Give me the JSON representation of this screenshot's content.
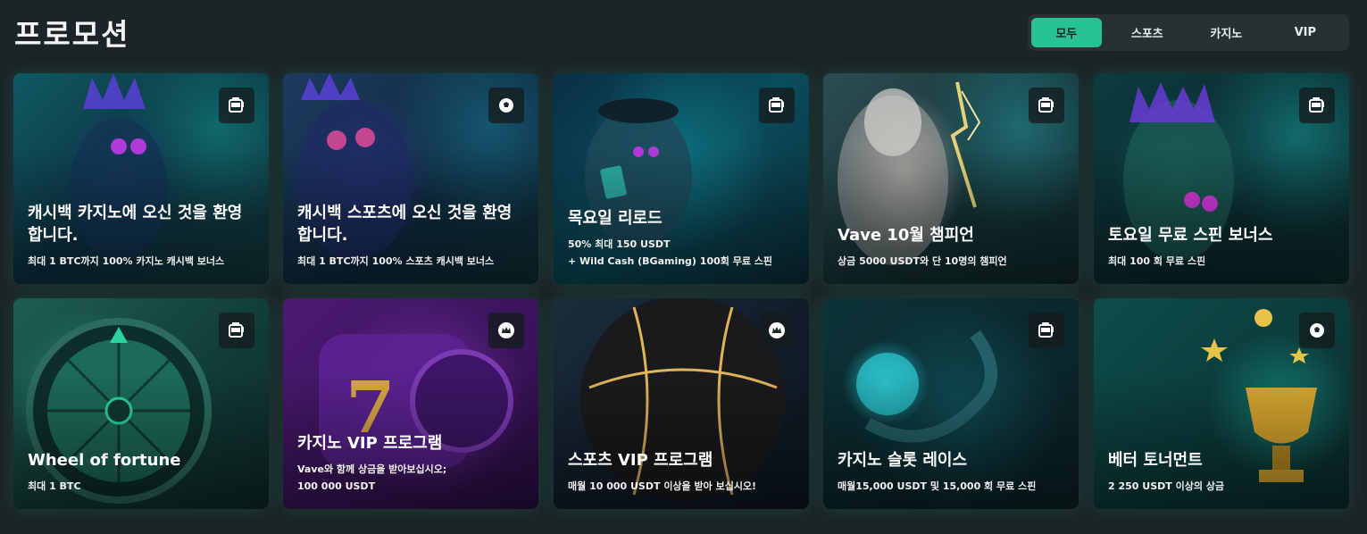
{
  "page": {
    "title": "프로모션"
  },
  "filters": [
    {
      "label": "모두",
      "active": true
    },
    {
      "label": "스포츠",
      "active": false
    },
    {
      "label": "카지노",
      "active": false
    },
    {
      "label": "VIP",
      "active": false
    }
  ],
  "promotions": [
    {
      "title": "캐시백 카지노에 오신 것을 환영 합니다.",
      "desc": "최대 1 BTC까지 100% 카지노 캐시백 보너스",
      "icon": "slot-machine-icon"
    },
    {
      "title": "캐시백 스포츠에 오신 것을 환영 합니다.",
      "desc": "최대 1 BTC까지 100% 스포츠 캐시백 보너스",
      "icon": "soccer-ball-icon"
    },
    {
      "title": "목요일 리로드",
      "desc": "50% 최대 150 USDT\n+ Wild Cash (BGaming) 100회 무료 스핀",
      "icon": "slot-machine-icon"
    },
    {
      "title": "Vave 10월 챔피언",
      "desc": "상금 5000 USDT와 단 10명의 챔피언",
      "icon": "slot-machine-icon"
    },
    {
      "title": "토요일 무료 스핀 보너스",
      "desc": "최대 100 회 무료 스핀",
      "icon": "slot-machine-icon"
    },
    {
      "title": "Wheel of fortune",
      "desc": "최대 1 BTC",
      "icon": "slot-machine-icon"
    },
    {
      "title": "카지노 VIP 프로그램",
      "desc": "Vave와 함께 상금을 받아보십시오;\n100 000 USDT",
      "icon": "crown-icon"
    },
    {
      "title": "스포츠 VIP 프로그램",
      "desc": "매월 10 000 USDT 이상을 받아 보십시오!",
      "icon": "crown-icon"
    },
    {
      "title": "카지노 슬롯 레이스",
      "desc": "매월15,000 USDT 및 15,000 회 무료 스핀",
      "icon": "slot-machine-icon"
    },
    {
      "title": "베터 토너먼트",
      "desc": "2 250 USDT 이상의 상금",
      "icon": "soccer-ball-icon"
    }
  ]
}
